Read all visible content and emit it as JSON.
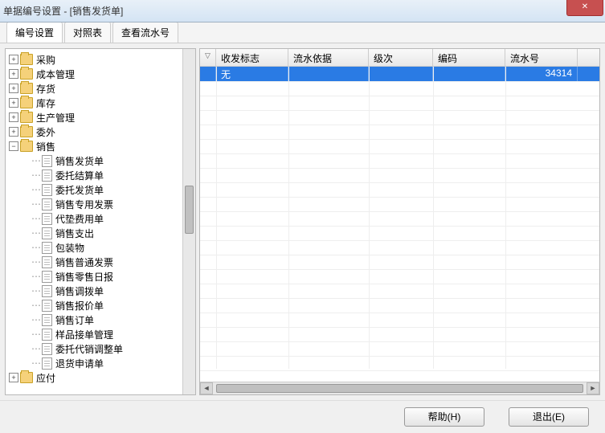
{
  "window": {
    "title": "单据编号设置 - [销售发货单]"
  },
  "tabs": [
    {
      "label": "编号设置",
      "active": true
    },
    {
      "label": "对照表",
      "active": false
    },
    {
      "label": "查看流水号",
      "active": false
    }
  ],
  "tree": {
    "folders": [
      {
        "label": "采购",
        "expanded": false
      },
      {
        "label": "成本管理",
        "expanded": false
      },
      {
        "label": "存货",
        "expanded": false
      },
      {
        "label": "库存",
        "expanded": false
      },
      {
        "label": "生产管理",
        "expanded": false
      },
      {
        "label": "委外",
        "expanded": false
      },
      {
        "label": "销售",
        "expanded": true
      },
      {
        "label": "应付",
        "expanded": false
      }
    ],
    "sales_children": [
      "销售发货单",
      "委托结算单",
      "委托发货单",
      "销售专用发票",
      "代垫费用单",
      "销售支出",
      "包装物",
      "销售普通发票",
      "销售零售日报",
      "销售调拨单",
      "销售报价单",
      "销售订单",
      "样品接单管理",
      "委托代销调整单",
      "退货申请单"
    ]
  },
  "grid": {
    "columns": [
      "收发标志",
      "流水依据",
      "级次",
      "编码",
      "流水号"
    ],
    "row": {
      "col1": "无",
      "col2": "",
      "col3": "",
      "col4": "",
      "col5": "34314"
    }
  },
  "footer": {
    "help": "帮助(H)",
    "exit": "退出(E)"
  }
}
